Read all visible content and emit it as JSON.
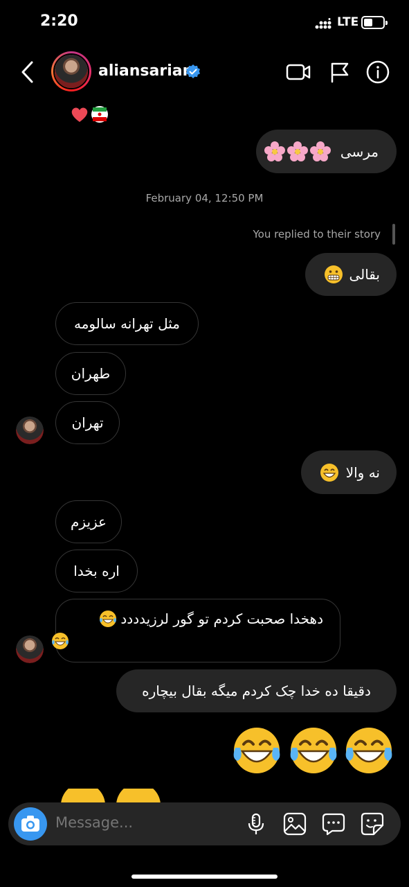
{
  "status_bar": {
    "time": "2:20",
    "network": "LTE"
  },
  "header": {
    "username": "aliansarian"
  },
  "messages": {
    "m1": "مرسی",
    "timestamp": "February 04, 12:50 PM",
    "reply_note": "You replied to their story",
    "m2": "بقالی",
    "m3": "مثل تهرانه سالومه",
    "m4": "طهران",
    "m5": "تهران",
    "m6": "نه والا",
    "m7": "عزیزم",
    "m8": "اره بخدا",
    "m9": "دهخدا صحبت کردم تو گور لرزیدددد",
    "m10": "دقیقا ده خدا چک کردم میگه بقال بیچاره"
  },
  "composer": {
    "placeholder": "Message..."
  },
  "icons": [
    "back-icon",
    "verified-icon",
    "video-call-icon",
    "flag-icon",
    "info-icon",
    "camera-icon",
    "microphone-icon",
    "gallery-icon",
    "chat-bubble-icon",
    "sticker-icon"
  ],
  "colors": {
    "accent": "#3897f0",
    "bubble_out": "#262626",
    "background": "#000000"
  }
}
